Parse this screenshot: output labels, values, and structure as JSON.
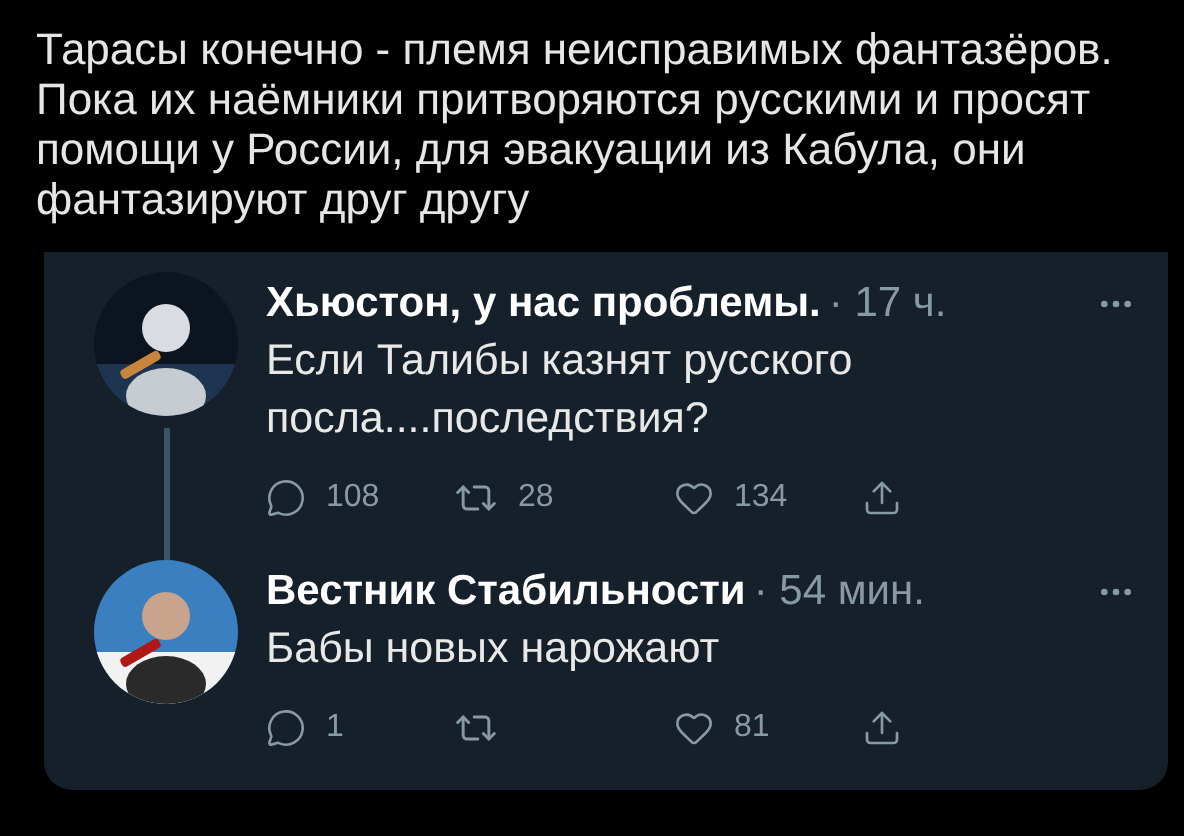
{
  "post": {
    "text": "Тарасы конечно - племя неисправимых фантазёров. Пока их наёмники притворяются русскими и просят помощи у России, для эвакуации из Кабула, они фантазируют друг другу"
  },
  "quoted_thread": [
    {
      "author": "Хьюстон, у нас проблемы.",
      "time": "· 17 ч.",
      "text": "Если Талибы казнят русского посла....последствия?",
      "replies": "108",
      "retweets": "28",
      "likes": "134",
      "thread_line": true
    },
    {
      "author": "Вестник Стабильности",
      "time": "· 54 мин.",
      "text": "Бабы новых нарожают",
      "replies": "1",
      "likes": "81",
      "thread_line": false
    }
  ]
}
